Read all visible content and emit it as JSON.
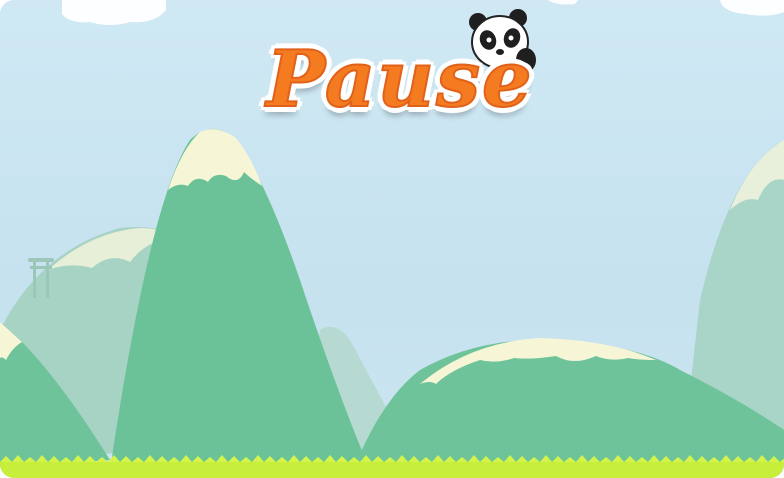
{
  "screen": {
    "title": "Pause"
  },
  "colors": {
    "sky": "#cfe8f4",
    "mountain_front": "#6ec39a",
    "mountain_back": "#a9d4c8",
    "snow": "#f6f6d6",
    "grass": "#c6ee3a",
    "title_fill": "#f47b20",
    "title_outline": "#ffffff"
  },
  "icons": {
    "mascot": "panda-icon",
    "gate": "torii-gate-icon"
  }
}
